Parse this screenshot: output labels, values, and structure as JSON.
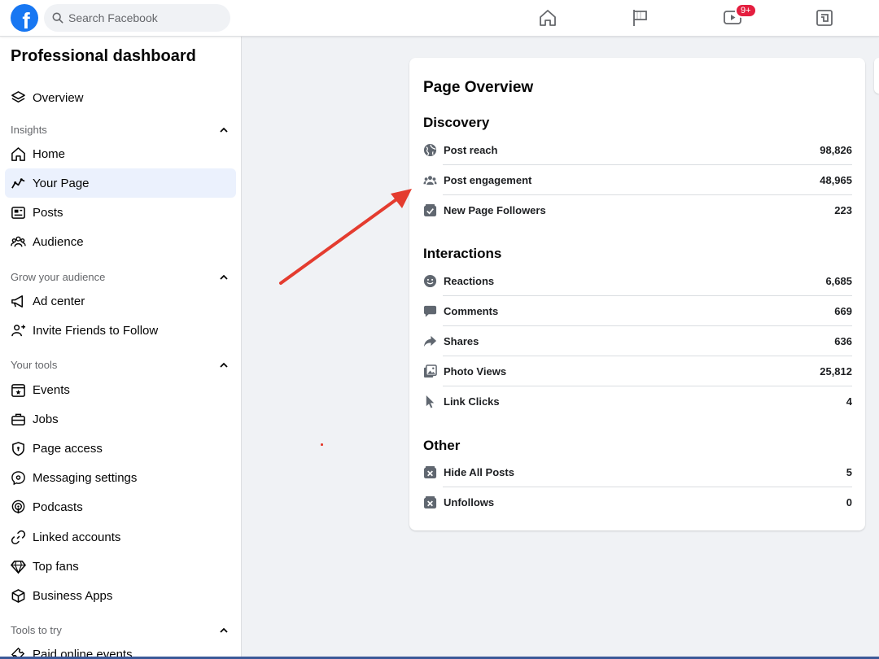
{
  "topbar": {
    "logo": "f",
    "search_placeholder": "Search Facebook",
    "watch_badge": "9+",
    "icons": [
      "home-icon",
      "flag-icon",
      "watch-icon",
      "gaming-icon"
    ]
  },
  "sidebar": {
    "title": "Professional dashboard",
    "overview": "Overview",
    "sections": {
      "insights": "Insights",
      "grow": "Grow your audience",
      "tools": "Your tools",
      "try": "Tools to try"
    },
    "items": {
      "home": "Home",
      "your_page": "Your Page",
      "posts": "Posts",
      "audience": "Audience",
      "ad_center": "Ad center",
      "invite": "Invite Friends to Follow",
      "events": "Events",
      "jobs": "Jobs",
      "page_access": "Page access",
      "messaging": "Messaging settings",
      "podcasts": "Podcasts",
      "linked": "Linked accounts",
      "top_fans": "Top fans",
      "business_apps": "Business Apps",
      "paid_events": "Paid online events"
    }
  },
  "overview": {
    "title": "Page Overview",
    "discovery": {
      "title": "Discovery",
      "rows": [
        {
          "label": "Post reach",
          "value": "98,826",
          "icon": "globe-icon"
        },
        {
          "label": "Post engagement",
          "value": "48,965",
          "icon": "people-icon"
        },
        {
          "label": "New Page Followers",
          "value": "223",
          "icon": "check-box-icon"
        }
      ]
    },
    "interactions": {
      "title": "Interactions",
      "rows": [
        {
          "label": "Reactions",
          "value": "6,685",
          "icon": "smiley-icon"
        },
        {
          "label": "Comments",
          "value": "669",
          "icon": "comment-icon"
        },
        {
          "label": "Shares",
          "value": "636",
          "icon": "share-icon"
        },
        {
          "label": "Photo Views",
          "value": "25,812",
          "icon": "photo-icon"
        },
        {
          "label": "Link Clicks",
          "value": "4",
          "icon": "cursor-icon"
        }
      ]
    },
    "other": {
      "title": "Other",
      "rows": [
        {
          "label": "Hide All Posts",
          "value": "5",
          "icon": "hide-icon"
        },
        {
          "label": "Unfollows",
          "value": "0",
          "icon": "unfollow-icon"
        }
      ]
    }
  },
  "colors": {
    "brand": "#1877f2",
    "badge": "#e41e3f",
    "annotation_arrow": "#e43c2f",
    "active_bg": "#ebf1fd"
  }
}
